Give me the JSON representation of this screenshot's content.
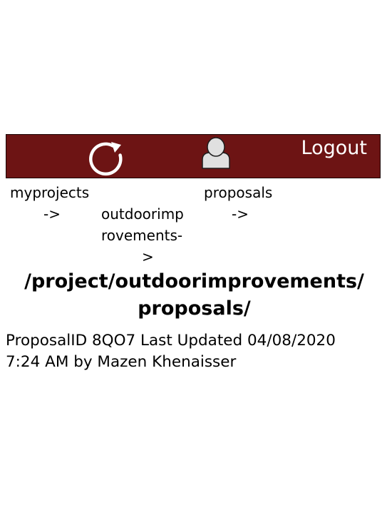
{
  "header": {
    "refresh_icon": "refresh-icon",
    "user_icon": "user-avatar-icon",
    "logout_label": "Logout",
    "bar_color": "#6d1414"
  },
  "breadcrumb": {
    "item1": "myprojects",
    "arrow1": "->",
    "item2_line1": "outdoorimp",
    "item2_line2": "rovements-",
    "arrow2": ">",
    "item3": "proposals",
    "arrow3": "->"
  },
  "path": {
    "line1": "/project/outdoorimprovements/",
    "line2": "proposals/"
  },
  "proposal_info": "ProposalID 8QO7 Last Updated 04/08/2020\n7:24 AM  by Mazen Khenaisser"
}
